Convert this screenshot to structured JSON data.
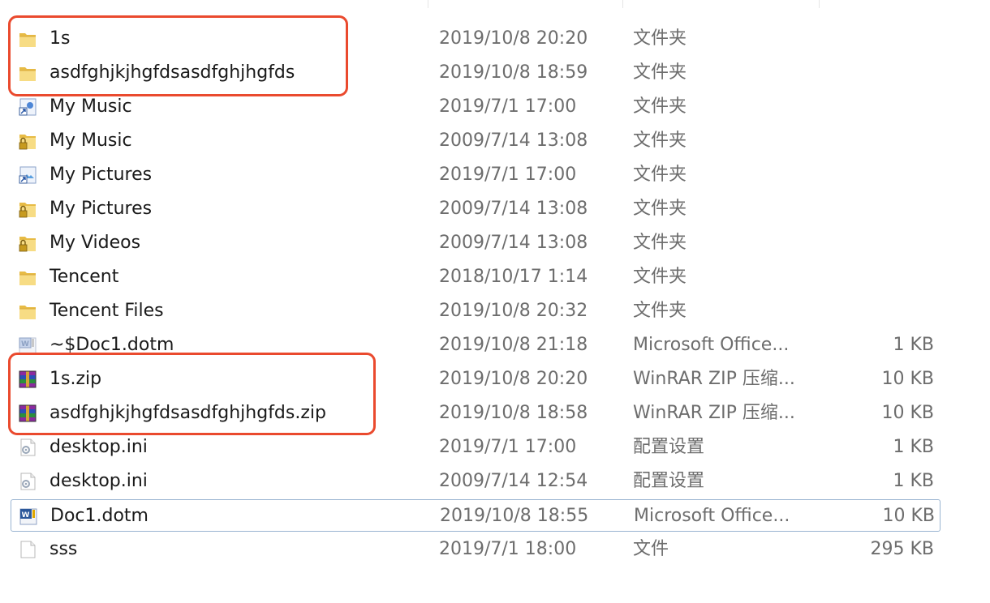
{
  "colors": {
    "highlight": "#ea4a2e",
    "focus_border": "#99b4d1",
    "secondary_text": "#6d6d6d"
  },
  "files": [
    {
      "name": "1s",
      "date": "2019/10/8 20:20",
      "type": "文件夹",
      "size": "",
      "icon": "folder-icon"
    },
    {
      "name": "asdfghjkjhgfdsasdfghjhgfds",
      "date": "2019/10/8 18:59",
      "type": "文件夹",
      "size": "",
      "icon": "folder-icon"
    },
    {
      "name": "My Music",
      "date": "2019/7/1 17:00",
      "type": "文件夹",
      "size": "",
      "icon": "shortcut-music-icon"
    },
    {
      "name": "My Music",
      "date": "2009/7/14 13:08",
      "type": "文件夹",
      "size": "",
      "icon": "locked-folder-icon"
    },
    {
      "name": "My Pictures",
      "date": "2019/7/1 17:00",
      "type": "文件夹",
      "size": "",
      "icon": "shortcut-pictures-icon"
    },
    {
      "name": "My Pictures",
      "date": "2009/7/14 13:08",
      "type": "文件夹",
      "size": "",
      "icon": "locked-folder-icon"
    },
    {
      "name": "My Videos",
      "date": "2009/7/14 13:08",
      "type": "文件夹",
      "size": "",
      "icon": "locked-folder-icon"
    },
    {
      "name": "Tencent",
      "date": "2018/10/17 1:14",
      "type": "文件夹",
      "size": "",
      "icon": "folder-icon"
    },
    {
      "name": "Tencent Files",
      "date": "2019/10/8 20:32",
      "type": "文件夹",
      "size": "",
      "icon": "folder-icon"
    },
    {
      "name": "~$Doc1.dotm",
      "date": "2019/10/8 21:18",
      "type": "Microsoft Office...",
      "size": "1 KB",
      "icon": "word-temp-icon"
    },
    {
      "name": "1s.zip",
      "date": "2019/10/8 20:20",
      "type": "WinRAR ZIP 压缩...",
      "size": "10 KB",
      "icon": "winrar-icon"
    },
    {
      "name": "asdfghjkjhgfdsasdfghjhgfds.zip",
      "date": "2019/10/8 18:58",
      "type": "WinRAR ZIP 压缩...",
      "size": "10 KB",
      "icon": "winrar-icon"
    },
    {
      "name": "desktop.ini",
      "date": "2019/7/1 17:00",
      "type": "配置设置",
      "size": "1 KB",
      "icon": "ini-file-icon"
    },
    {
      "name": "desktop.ini",
      "date": "2009/7/14 12:54",
      "type": "配置设置",
      "size": "1 KB",
      "icon": "ini-file-icon"
    },
    {
      "name": "Doc1.dotm",
      "date": "2019/10/8 18:55",
      "type": "Microsoft Office...",
      "size": "10 KB",
      "icon": "word-template-icon"
    },
    {
      "name": "sss",
      "date": "2019/7/1 18:00",
      "type": "文件",
      "size": "295 KB",
      "icon": "blank-file-icon"
    }
  ]
}
